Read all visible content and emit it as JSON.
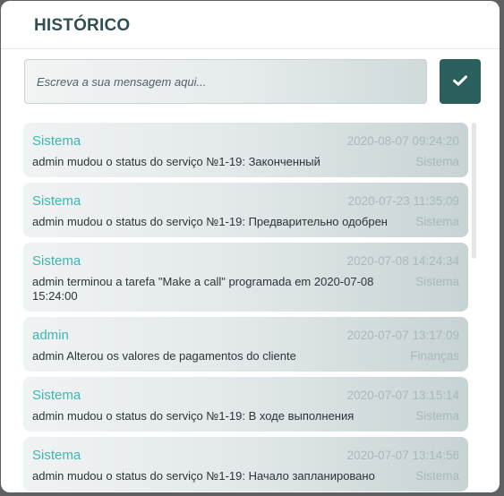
{
  "header": {
    "title": "HISTÓRICO"
  },
  "composer": {
    "placeholder": "Escreva a sua mensagem aqui...",
    "send_icon": "check-icon"
  },
  "entries": [
    {
      "author": "Sistema",
      "time": "2020-08-07 09:24:20",
      "message": "admin mudou o status do serviço №1-19: Законченный",
      "category": "Sistema"
    },
    {
      "author": "Sistema",
      "time": "2020-07-23 11:35:09",
      "message": "admin mudou o status do serviço №1-19: Предварительно одобрен",
      "category": "Sistema"
    },
    {
      "author": "Sistema",
      "time": "2020-07-08 14:24:34",
      "message": "admin terminou a tarefa \"Make a call\" programada em 2020-07-08 15:24:00",
      "category": "Sistema"
    },
    {
      "author": "admin",
      "time": "2020-07-07 13:17:09",
      "message": "admin Alterou os valores de pagamentos do cliente",
      "category": "Finanças"
    },
    {
      "author": "Sistema",
      "time": "2020-07-07 13:15:14",
      "message": "admin mudou o status do serviço №1-19: В ходе выполнения",
      "category": "Sistema"
    },
    {
      "author": "Sistema",
      "time": "2020-07-07 13:14:56",
      "message": "admin mudou o status do serviço №1-19: Начало запланировано",
      "category": "Sistema"
    }
  ]
}
